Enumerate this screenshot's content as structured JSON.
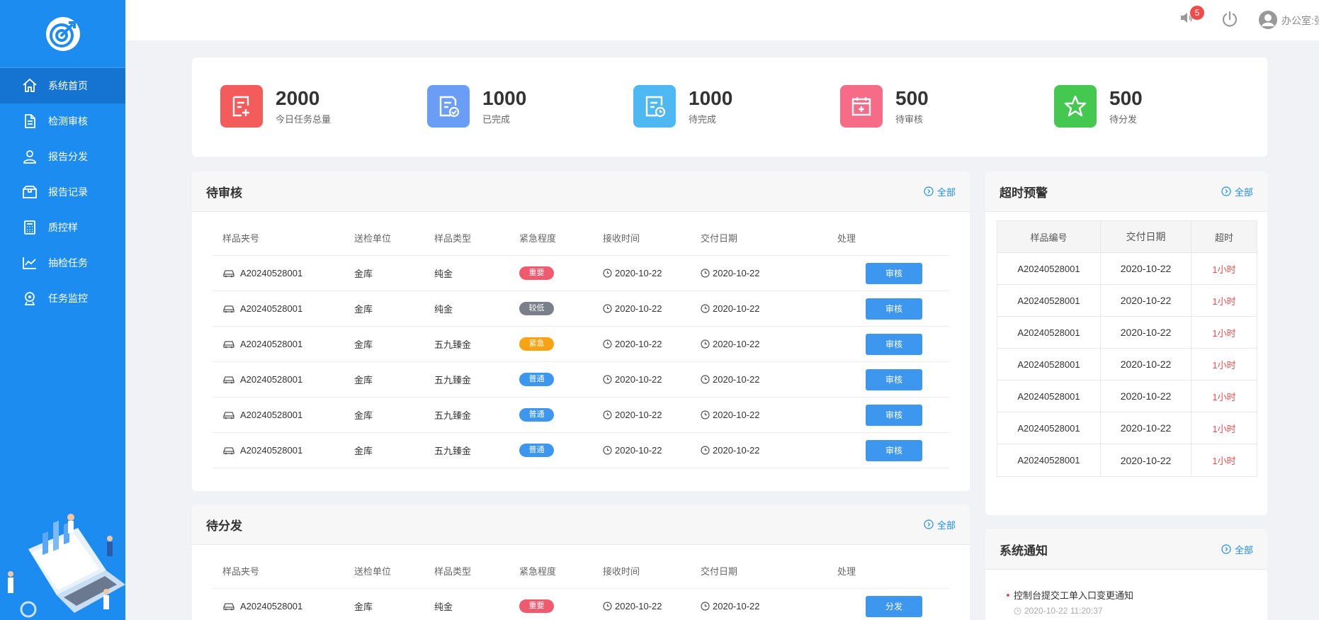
{
  "sidebar": {
    "items": [
      {
        "label": "系统首页",
        "icon": "home-icon",
        "active": true
      },
      {
        "label": "检测审核",
        "icon": "document-icon"
      },
      {
        "label": "报告分发",
        "icon": "distribute-icon"
      },
      {
        "label": "报告记录",
        "icon": "box-icon"
      },
      {
        "label": "质控样",
        "icon": "calculator-icon"
      },
      {
        "label": "抽检任务",
        "icon": "chart-icon"
      },
      {
        "label": "任务监控",
        "icon": "monitor-icon"
      }
    ]
  },
  "header": {
    "notification_count": "5",
    "user_name": "办公室:张"
  },
  "stats": [
    {
      "value": "2000",
      "label": "今日任务总量",
      "color": "#f45b5b",
      "icon": "task-add-icon"
    },
    {
      "value": "1000",
      "label": "已完成",
      "color": "#6a9df5",
      "icon": "doc-check-icon"
    },
    {
      "value": "1000",
      "label": "待完成",
      "color": "#4eb8f2",
      "icon": "doc-clock-icon"
    },
    {
      "value": "500",
      "label": "待审核",
      "color": "#f66b86",
      "icon": "calendar-plus-icon"
    },
    {
      "value": "500",
      "label": "待分发",
      "color": "#45c84f",
      "icon": "star-icon"
    }
  ],
  "review": {
    "title": "待审核",
    "more": "全部",
    "headers": [
      "样品夹号",
      "送检单位",
      "样品类型",
      "紧急程度",
      "接收时间",
      "交付日期",
      "处理"
    ],
    "rows": [
      {
        "id": "A20240528001",
        "unit": "金库",
        "type": "纯金",
        "urgency": "重要",
        "received": "2020-10-22",
        "delivery": "2020-10-22",
        "action": "审核"
      },
      {
        "id": "A20240528001",
        "unit": "金库",
        "type": "纯金",
        "urgency": "较低",
        "received": "2020-10-22",
        "delivery": "2020-10-22",
        "action": "审核"
      },
      {
        "id": "A20240528001",
        "unit": "金库",
        "type": "五九臻金",
        "urgency": "紧急",
        "received": "2020-10-22",
        "delivery": "2020-10-22",
        "action": "审核"
      },
      {
        "id": "A20240528001",
        "unit": "金库",
        "type": "五九臻金",
        "urgency": "普通",
        "received": "2020-10-22",
        "delivery": "2020-10-22",
        "action": "审核"
      },
      {
        "id": "A20240528001",
        "unit": "金库",
        "type": "五九臻金",
        "urgency": "普通",
        "received": "2020-10-22",
        "delivery": "2020-10-22",
        "action": "审核"
      },
      {
        "id": "A20240528001",
        "unit": "金库",
        "type": "五九臻金",
        "urgency": "普通",
        "received": "2020-10-22",
        "delivery": "2020-10-22",
        "action": "审核"
      }
    ]
  },
  "distribute": {
    "title": "待分发",
    "more": "全部",
    "headers": [
      "样品夹号",
      "送检单位",
      "样品类型",
      "紧急程度",
      "接收时间",
      "交付日期",
      "处理"
    ],
    "rows": [
      {
        "id": "A20240528001",
        "unit": "金库",
        "type": "纯金",
        "urgency": "重要",
        "received": "2020-10-22",
        "delivery": "2020-10-22",
        "action": "分发"
      }
    ]
  },
  "urgency_colors": {
    "重要": "#f05a6e",
    "较低": "#7a7f8a",
    "紧急": "#f7a313",
    "普通": "#3d97ef"
  },
  "overdue": {
    "title": "超时预警",
    "more": "全部",
    "headers": [
      "样品编号",
      "交付日期",
      "超时"
    ],
    "rows": [
      [
        "A20240528001",
        "2020-10-22",
        "1小时"
      ],
      [
        "A20240528001",
        "2020-10-22",
        "1小时"
      ],
      [
        "A20240528001",
        "2020-10-22",
        "1小时"
      ],
      [
        "A20240528001",
        "2020-10-22",
        "1小时"
      ],
      [
        "A20240528001",
        "2020-10-22",
        "1小时"
      ],
      [
        "A20240528001",
        "2020-10-22",
        "1小时"
      ],
      [
        "A20240528001",
        "2020-10-22",
        "1小时"
      ]
    ]
  },
  "notice": {
    "title": "系统通知",
    "more": "全部",
    "items": [
      {
        "title": "控制台提交工单入口变更通知",
        "time": "2020-10-22 11:20:37"
      }
    ]
  }
}
